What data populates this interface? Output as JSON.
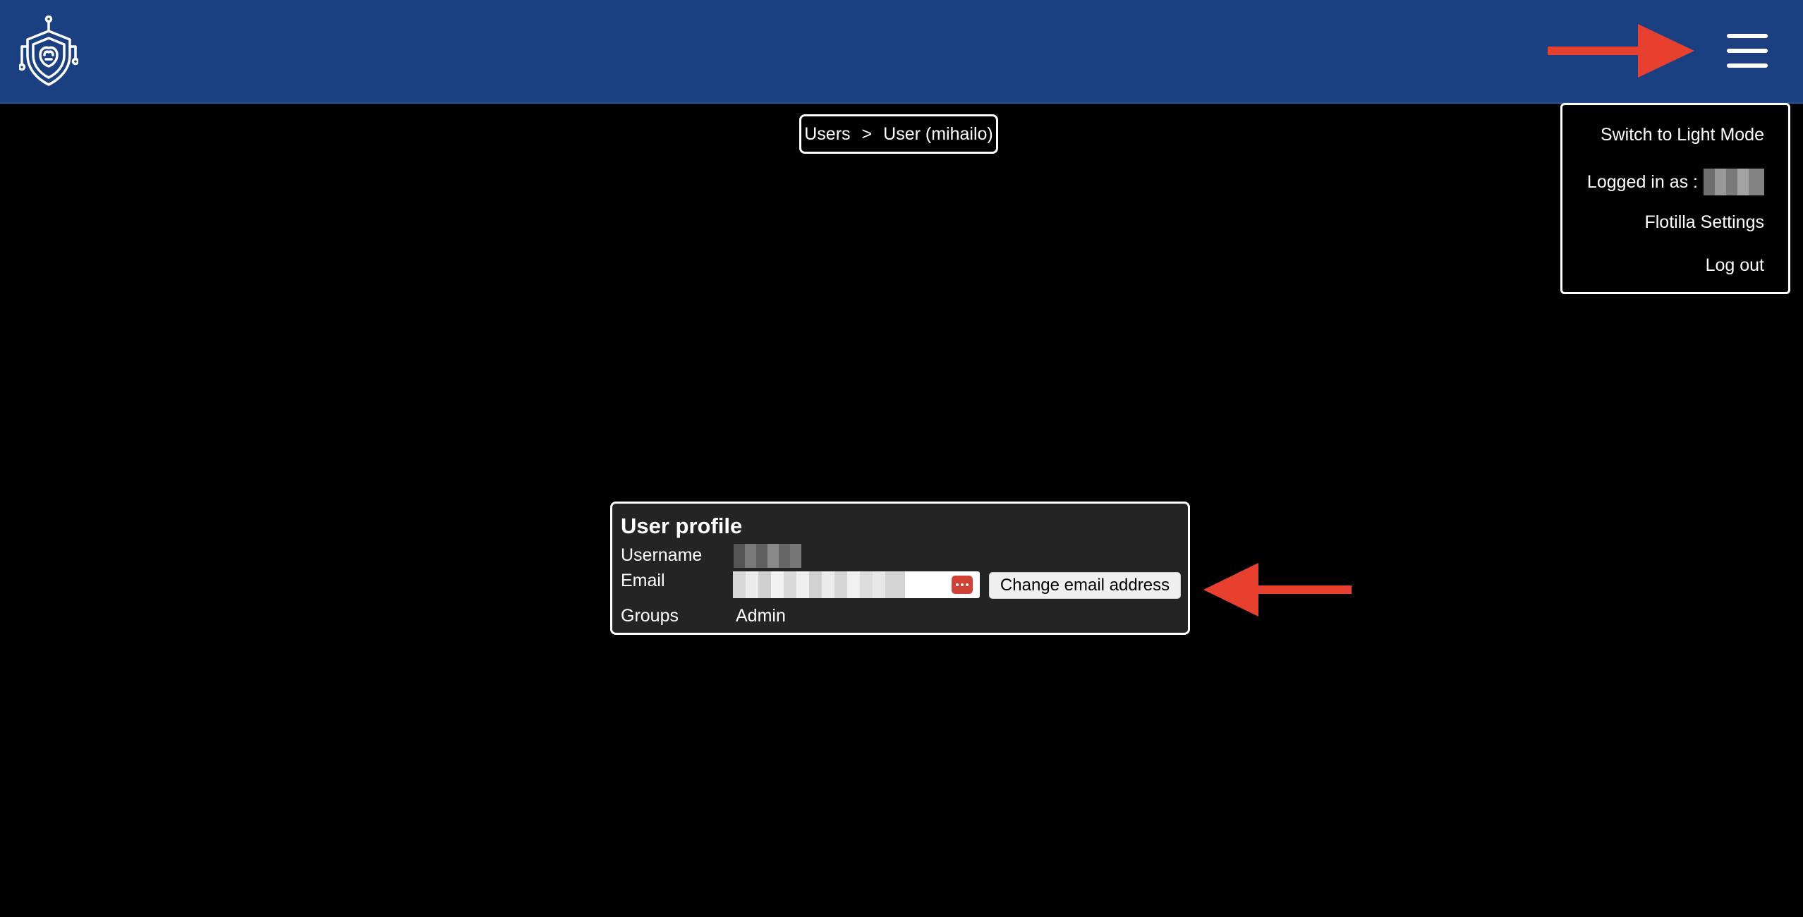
{
  "header": {
    "logo_icon": "shield-circuit-logo-icon",
    "menu_icon": "hamburger-menu-icon",
    "background_color": "#1a4081"
  },
  "breadcrumb": {
    "items": [
      {
        "label": "Users"
      },
      {
        "label": "User (mihailo)"
      }
    ],
    "separator": ">"
  },
  "menu": {
    "items": [
      {
        "label": "Switch to Light Mode"
      },
      {
        "label": "Logged in as :"
      },
      {
        "label": "Flotilla Settings"
      },
      {
        "label": "Log out"
      }
    ]
  },
  "profile": {
    "title": "User profile",
    "username_label": "Username",
    "email_label": "Email",
    "groups_label": "Groups",
    "groups_value": "Admin",
    "change_email_label": "Change email address",
    "password_manager_icon": "password-manager-icon"
  },
  "annotations": {
    "arrow_color": "#e8402f"
  }
}
